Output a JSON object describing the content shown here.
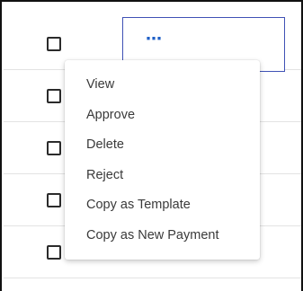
{
  "table": {
    "rows": 5
  },
  "row_actions": {
    "trigger_glyph": "⋯",
    "trigger_icon": "more-horizontal-icon"
  },
  "context_menu": {
    "items": [
      {
        "label": "View"
      },
      {
        "label": "Approve"
      },
      {
        "label": "Delete"
      },
      {
        "label": "Reject"
      },
      {
        "label": "Copy as Template"
      },
      {
        "label": "Copy as New Payment"
      }
    ]
  },
  "colors": {
    "accent": "#1f5fc6",
    "focus_border": "#3f51b5",
    "menu_text": "#3a3a3a"
  }
}
